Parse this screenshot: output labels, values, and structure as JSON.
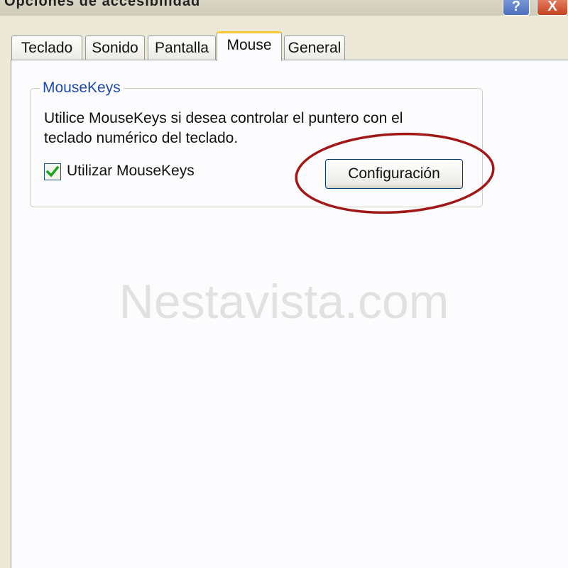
{
  "window": {
    "title": "Opciones de accesibilidad",
    "help_label": "?",
    "close_label": "X"
  },
  "tabs": [
    {
      "label": "Teclado",
      "active": false
    },
    {
      "label": "Sonido",
      "active": false
    },
    {
      "label": "Pantalla",
      "active": false
    },
    {
      "label": "Mouse",
      "active": true
    },
    {
      "label": "General",
      "active": false
    }
  ],
  "mousekeys": {
    "group_title": "MouseKeys",
    "description": "Utilice MouseKeys si desea controlar el puntero con el teclado numérico del teclado.",
    "checkbox_label": "Utilizar MouseKeys",
    "checkbox_checked": true,
    "settings_button": "Configuración"
  },
  "watermark": "Nestavista.com",
  "colors": {
    "highlight_ellipse": "#a01818",
    "group_title": "#1f4aa8",
    "checkmark": "#21a121",
    "active_tab_accent": "#ffc83c"
  }
}
